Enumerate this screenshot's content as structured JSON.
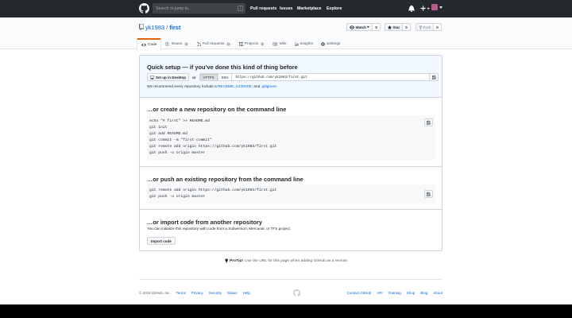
{
  "header": {
    "search_placeholder": "Search or jump to...",
    "search_shortcut": "/",
    "nav": [
      "Pull requests",
      "Issues",
      "Marketplace",
      "Explore"
    ],
    "icons": [
      "bell-icon",
      "plus-icon",
      "avatar"
    ]
  },
  "repo": {
    "owner": "yk1983",
    "separator": "/",
    "name": "first",
    "actions": {
      "watch_label": "Watch",
      "watch_count": "0",
      "star_label": "Star",
      "star_count": "0",
      "fork_label": "Fork",
      "fork_count": "0"
    },
    "tabs": [
      {
        "label": "Code",
        "counter": ""
      },
      {
        "label": "Issues",
        "counter": "0"
      },
      {
        "label": "Pull requests",
        "counter": "0"
      },
      {
        "label": "Projects",
        "counter": "0"
      },
      {
        "label": "Wiki",
        "counter": ""
      },
      {
        "label": "Insights",
        "counter": ""
      },
      {
        "label": "Settings",
        "counter": ""
      }
    ]
  },
  "quick_setup": {
    "title": "Quick setup — if you’ve done this kind of thing before",
    "desktop_button": "Set up in Desktop",
    "or": "or",
    "https": "HTTPS",
    "ssh": "SSH",
    "url": "https://github.com/yk1983/first.git",
    "recommend_prefix": "We recommend every repository include a",
    "readme": "README",
    "license": "LICENSE",
    "and": "and",
    "gitignore": ".gitignore"
  },
  "new_repo": {
    "title": "…or create a new repository on the command line",
    "lines": [
      "echo \"# first\" >> README.md",
      "git init",
      "git add README.md",
      "git commit -m \"first commit\"",
      "git remote add origin https://github.com/yk1983/first.git",
      "git push -u origin master"
    ]
  },
  "push_existing": {
    "title": "…or push an existing repository from the command line",
    "lines": [
      "git remote add origin https://github.com/yk1983/first.git",
      "git push -u origin master"
    ]
  },
  "import": {
    "title": "…or import code from another repository",
    "description": "You can initialize this repository with code from a Subversion, Mercurial, or TFS project.",
    "button": "Import code"
  },
  "protip": {
    "label": "ProTip!",
    "text": "Use the URL for this page when adding GitHub as a remote."
  },
  "footer": {
    "copyright": "© 2018 GitHub, Inc.",
    "left_links": [
      "Terms",
      "Privacy",
      "Security",
      "Status",
      "Help"
    ],
    "right_links": [
      "Contact GitHub",
      "API",
      "Training",
      "Shop",
      "Blog",
      "About"
    ]
  },
  "colors": {
    "header_bg": "#24292e",
    "link": "#0366d6",
    "quick_bg": "#f1f8ff",
    "tab_accent": "#e36209"
  }
}
